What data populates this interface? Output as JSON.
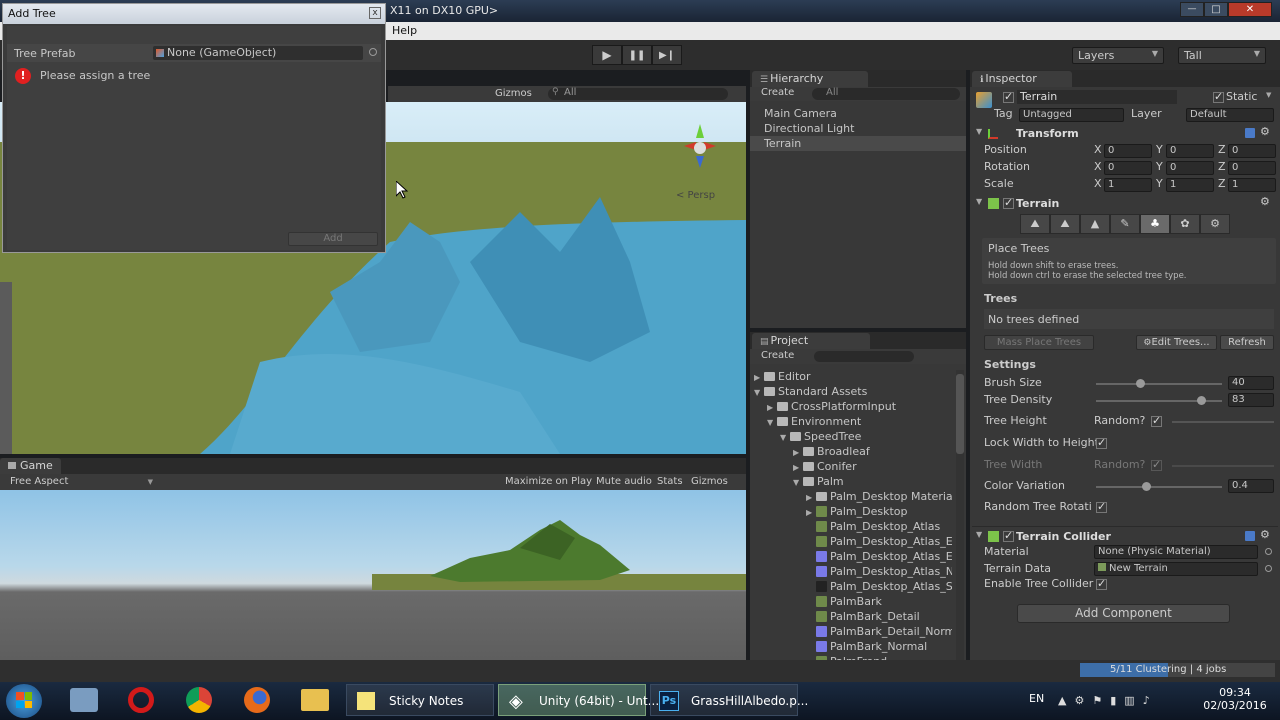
{
  "top_bar": {
    "title_fragment": "X11 on DX10 GPU>",
    "menu_help": "Help"
  },
  "window_controls": {
    "minimize": "—",
    "maximize": "□",
    "close": "✕"
  },
  "toolbar": {
    "layers_label": "Layers",
    "layout_label": "Tall",
    "play": "▶",
    "pause": "❚❚",
    "step": "▶❙"
  },
  "add_tree_dialog": {
    "title": "Add Tree",
    "close": "x",
    "prefab_label": "Tree Prefab",
    "prefab_value": "None (GameObject)",
    "error_text": "Please assign a tree",
    "add_button": "Add"
  },
  "scene_view": {
    "gizmos_label": "Gizmos",
    "search_placeholder": "All",
    "persp_label": "< Persp"
  },
  "game_view": {
    "tab_label": "Game",
    "aspect_label": "Free Aspect",
    "maximize_label": "Maximize on Play",
    "mute_label": "Mute audio",
    "stats_label": "Stats",
    "gizmos_label": "Gizmos"
  },
  "hierarchy": {
    "tab_label": "Hierarchy",
    "create_label": "Create",
    "search_placeholder": "All",
    "items": [
      "Main Camera",
      "Directional Light",
      "Terrain"
    ],
    "selected_index": 2
  },
  "project": {
    "tab_label": "Project",
    "create_label": "Create",
    "items": [
      {
        "label": "Editor",
        "kind": "folder",
        "indent": 0,
        "arrow": "▶"
      },
      {
        "label": "Standard Assets",
        "kind": "folder",
        "indent": 0,
        "arrow": "▼"
      },
      {
        "label": "CrossPlatformInput",
        "kind": "folder",
        "indent": 1,
        "arrow": "▶"
      },
      {
        "label": "Environment",
        "kind": "folder",
        "indent": 1,
        "arrow": "▼"
      },
      {
        "label": "SpeedTree",
        "kind": "folder",
        "indent": 2,
        "arrow": "▼"
      },
      {
        "label": "Broadleaf",
        "kind": "folder",
        "indent": 3,
        "arrow": "▶"
      },
      {
        "label": "Conifer",
        "kind": "folder",
        "indent": 3,
        "arrow": "▶"
      },
      {
        "label": "Palm",
        "kind": "folder",
        "indent": 3,
        "arrow": "▼"
      },
      {
        "label": "Palm_Desktop Materia",
        "kind": "folder",
        "indent": 4,
        "arrow": "▶"
      },
      {
        "label": "Palm_Desktop",
        "kind": "asset",
        "indent": 4,
        "arrow": "▶"
      },
      {
        "label": "Palm_Desktop_Atlas",
        "kind": "asset",
        "indent": 4,
        "arrow": ""
      },
      {
        "label": "Palm_Desktop_Atlas_E",
        "kind": "asset",
        "indent": 4,
        "arrow": ""
      },
      {
        "label": "Palm_Desktop_Atlas_E",
        "kind": "asset-blue",
        "indent": 4,
        "arrow": ""
      },
      {
        "label": "Palm_Desktop_Atlas_N",
        "kind": "asset-blue",
        "indent": 4,
        "arrow": ""
      },
      {
        "label": "Palm_Desktop_Atlas_S",
        "kind": "asset-dark",
        "indent": 4,
        "arrow": ""
      },
      {
        "label": "PalmBark",
        "kind": "asset",
        "indent": 4,
        "arrow": ""
      },
      {
        "label": "PalmBark_Detail",
        "kind": "asset",
        "indent": 4,
        "arrow": ""
      },
      {
        "label": "PalmBark_Detail_Norm",
        "kind": "asset-blue",
        "indent": 4,
        "arrow": ""
      },
      {
        "label": "PalmBark_Normal",
        "kind": "asset-blue",
        "indent": 4,
        "arrow": ""
      },
      {
        "label": "PalmFrond",
        "kind": "asset",
        "indent": 4,
        "arrow": ""
      }
    ]
  },
  "inspector": {
    "tab_label": "Inspector",
    "object_name": "Terrain",
    "static_label": "Static",
    "tag_label": "Tag",
    "tag_value": "Untagged",
    "layer_label": "Layer",
    "layer_value": "Default",
    "transform": {
      "title": "Transform",
      "rows": [
        {
          "label": "Position",
          "x": "0",
          "y": "0",
          "z": "0"
        },
        {
          "label": "Rotation",
          "x": "0",
          "y": "0",
          "z": "0"
        },
        {
          "label": "Scale",
          "x": "1",
          "y": "1",
          "z": "1"
        }
      ],
      "axis_x": "X",
      "axis_y": "Y",
      "axis_z": "Z"
    },
    "terrain": {
      "title": "Terrain",
      "place_trees_title": "Place Trees",
      "help_line1": "Hold down shift to erase trees.",
      "help_line2": "Hold down ctrl to erase the selected tree type.",
      "trees_header": "Trees",
      "no_trees": "No trees defined",
      "mass_place": "Mass Place Trees",
      "edit_trees": "Edit Trees...",
      "refresh": "Refresh",
      "settings_header": "Settings",
      "brush_size_label": "Brush Size",
      "brush_size_value": "40",
      "brush_size_fraction": 0.35,
      "tree_density_label": "Tree Density",
      "tree_density_value": "83",
      "tree_density_fraction": 0.83,
      "tree_height_label": "Tree Height",
      "random_label": "Random?",
      "lock_width_label": "Lock Width to Height",
      "tree_width_label": "Tree Width",
      "color_variation_label": "Color Variation",
      "color_variation_value": "0.4",
      "color_variation_fraction": 0.4,
      "random_rotation_label": "Random Tree Rotati"
    },
    "collider": {
      "title": "Terrain Collider",
      "material_label": "Material",
      "material_value": "None (Physic Material)",
      "terrain_data_label": "Terrain Data",
      "terrain_data_value": "New Terrain",
      "enable_tree_label": "Enable Tree Collider"
    },
    "add_component": "Add Component"
  },
  "status": {
    "progress_text": "5/11 Clustering | 4 jobs",
    "progress_fraction": 0.45
  },
  "taskbar": {
    "sticky_notes": "Sticky Notes",
    "unity_label": "Unity (64bit) - Unt...",
    "ps_label": "GrassHillAlbedo.p...",
    "lang": "EN",
    "time": "09:34",
    "date": "02/03/2016"
  },
  "colors": {
    "accent": "#3d6ea8",
    "error": "#e02020",
    "taskbar": "#101a2a"
  }
}
